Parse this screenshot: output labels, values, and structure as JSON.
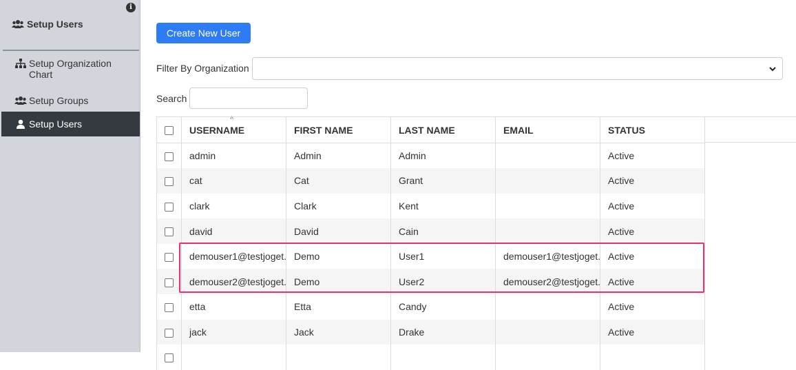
{
  "sidebar": {
    "header": "Setup Users",
    "items": [
      {
        "label": "Setup Organization Chart",
        "icon": "sitemap-icon"
      },
      {
        "label": "Setup Groups",
        "icon": "users-icon"
      },
      {
        "label": "Setup Users",
        "icon": "user-icon",
        "active": true
      }
    ]
  },
  "main": {
    "create_button": "Create New User",
    "filter_label": "Filter By Organization",
    "filter_value": "",
    "search_label": "Search",
    "search_value": ""
  },
  "table": {
    "columns": [
      "USERNAME",
      "FIRST NAME",
      "LAST NAME",
      "EMAIL",
      "STATUS"
    ],
    "rows": [
      {
        "username": "admin",
        "first": "Admin",
        "last": "Admin",
        "email": "",
        "status": "Active"
      },
      {
        "username": "cat",
        "first": "Cat",
        "last": "Grant",
        "email": "",
        "status": "Active"
      },
      {
        "username": "clark",
        "first": "Clark",
        "last": "Kent",
        "email": "",
        "status": "Active"
      },
      {
        "username": "david",
        "first": "David",
        "last": "Cain",
        "email": "",
        "status": "Active"
      },
      {
        "username": "demouser1@testjoget.",
        "first": "Demo",
        "last": "User1",
        "email": "demouser1@testjoget.",
        "status": "Active"
      },
      {
        "username": "demouser2@testjoget.",
        "first": "Demo",
        "last": "User2",
        "email": "demouser2@testjoget.",
        "status": "Active"
      },
      {
        "username": "etta",
        "first": "Etta",
        "last": "Candy",
        "email": "",
        "status": "Active"
      },
      {
        "username": "jack",
        "first": "Jack",
        "last": "Drake",
        "email": "",
        "status": "Active"
      },
      {
        "username": "",
        "first": "",
        "last": "",
        "email": "",
        "status": ""
      }
    ]
  },
  "colors": {
    "sidebar_bg": "#d2d6dc",
    "active_item_bg": "#343a40",
    "primary_button": "#2d7cf6",
    "highlight_border": "#e8336a"
  }
}
